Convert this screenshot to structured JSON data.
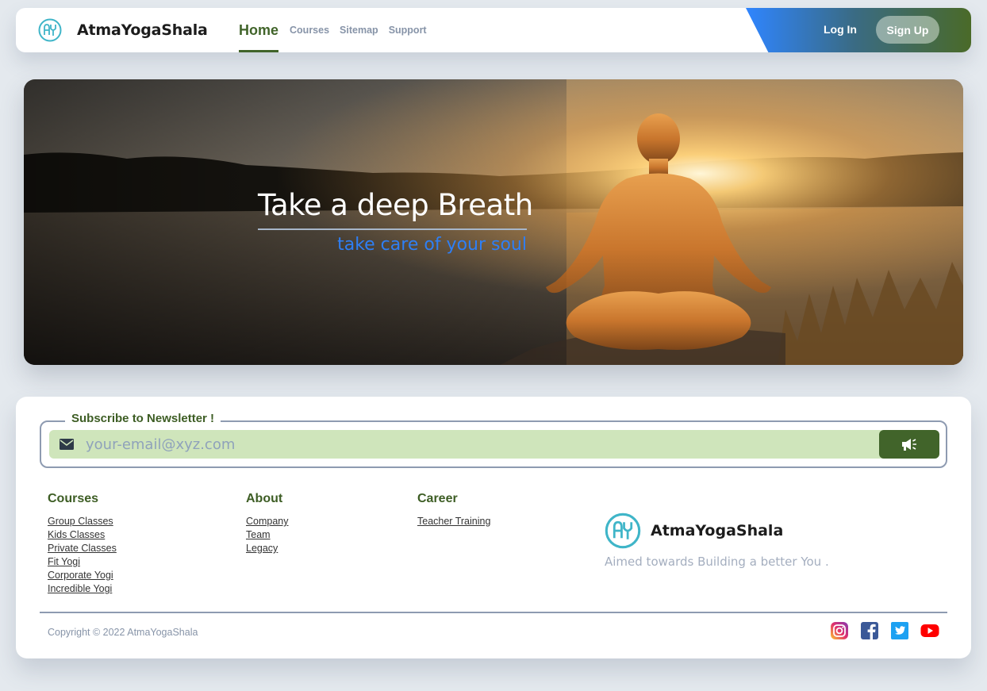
{
  "header": {
    "brand_name": "AtmaYogaShala",
    "nav": {
      "home": "Home",
      "courses": "Courses",
      "sitemap": "Sitemap",
      "support": "Support"
    },
    "login_label": "Log In",
    "signup_label": "Sign Up"
  },
  "hero": {
    "title": "Take a deep Breath",
    "subtitle": "take care of your soul"
  },
  "newsletter": {
    "legend": "Subscribe to Newsletter !",
    "placeholder": "your-email@xyz.com"
  },
  "footer": {
    "columns": [
      {
        "title": "Courses",
        "links": [
          "Group Classes",
          "Kids Classes",
          "Private Classes",
          "Fit Yogi",
          "Corporate Yogi",
          "Incredible Yogi"
        ]
      },
      {
        "title": "About",
        "links": [
          "Company",
          "Team",
          "Legacy"
        ]
      },
      {
        "title": "Career",
        "links": [
          "Teacher Training"
        ]
      }
    ],
    "brand_name": "AtmaYogaShala",
    "tagline": "Aimed towards Building a better You .",
    "copyright": "Copyright © 2022 AtmaYogaShala",
    "socials": [
      "instagram-icon",
      "facebook-icon",
      "twitter-icon",
      "youtube-icon"
    ]
  },
  "colors": {
    "accent_green": "#41642a",
    "accent_blue": "#2f85ff",
    "input_bg": "#cfe5bb",
    "page_bg": "#e4e9ee"
  }
}
